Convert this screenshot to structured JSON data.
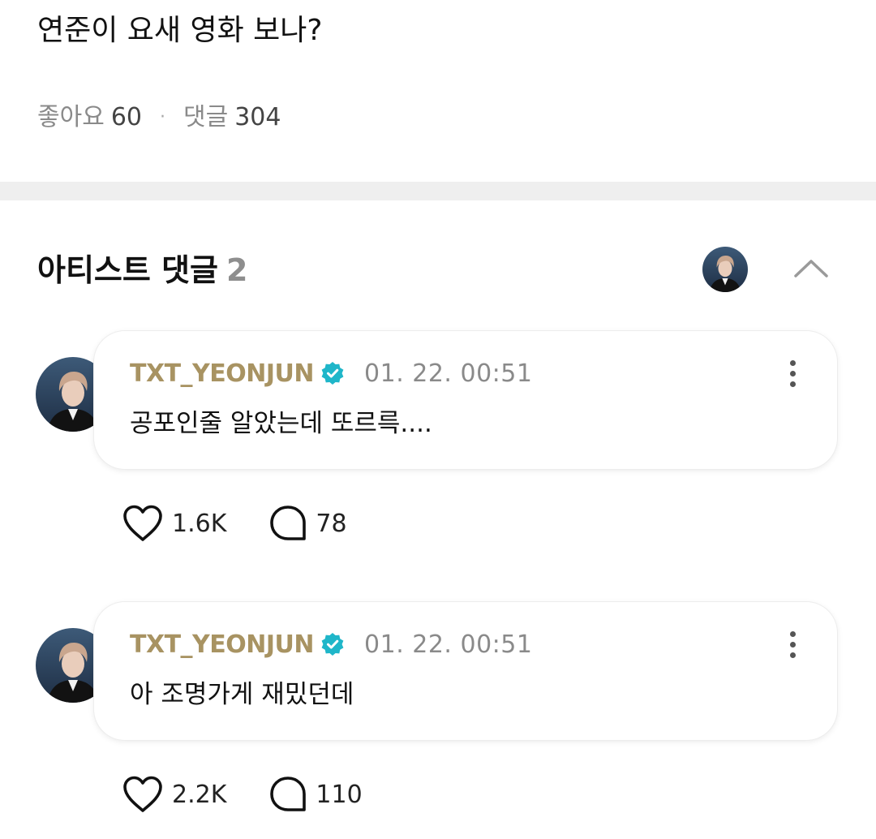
{
  "post": {
    "title": "연준이 요새 영화 보나?",
    "likes_label": "좋아요",
    "likes_count": "60",
    "separator": "·",
    "comments_label": "댓글",
    "comments_count": "304"
  },
  "artist_section": {
    "title": "아티스트 댓글",
    "count": "2",
    "collapse_icon": "chevron-up-icon"
  },
  "comments": [
    {
      "author": "TXT_YEONJUN",
      "verified_icon": "verified-badge-icon",
      "time": "01. 22. 00:51",
      "text": "공포인줄 알았는데 또르륵....",
      "like_count": "1.6K",
      "reply_count": "78"
    },
    {
      "author": "TXT_YEONJUN",
      "verified_icon": "verified-badge-icon",
      "time": "01. 22. 00:51",
      "text": "아 조명가게 재밌던데",
      "like_count": "2.2K",
      "reply_count": "110"
    }
  ],
  "colors": {
    "author": "#a89362",
    "verified": "#1fb6c9",
    "muted": "#8a8a8a",
    "divider": "#efefef"
  }
}
